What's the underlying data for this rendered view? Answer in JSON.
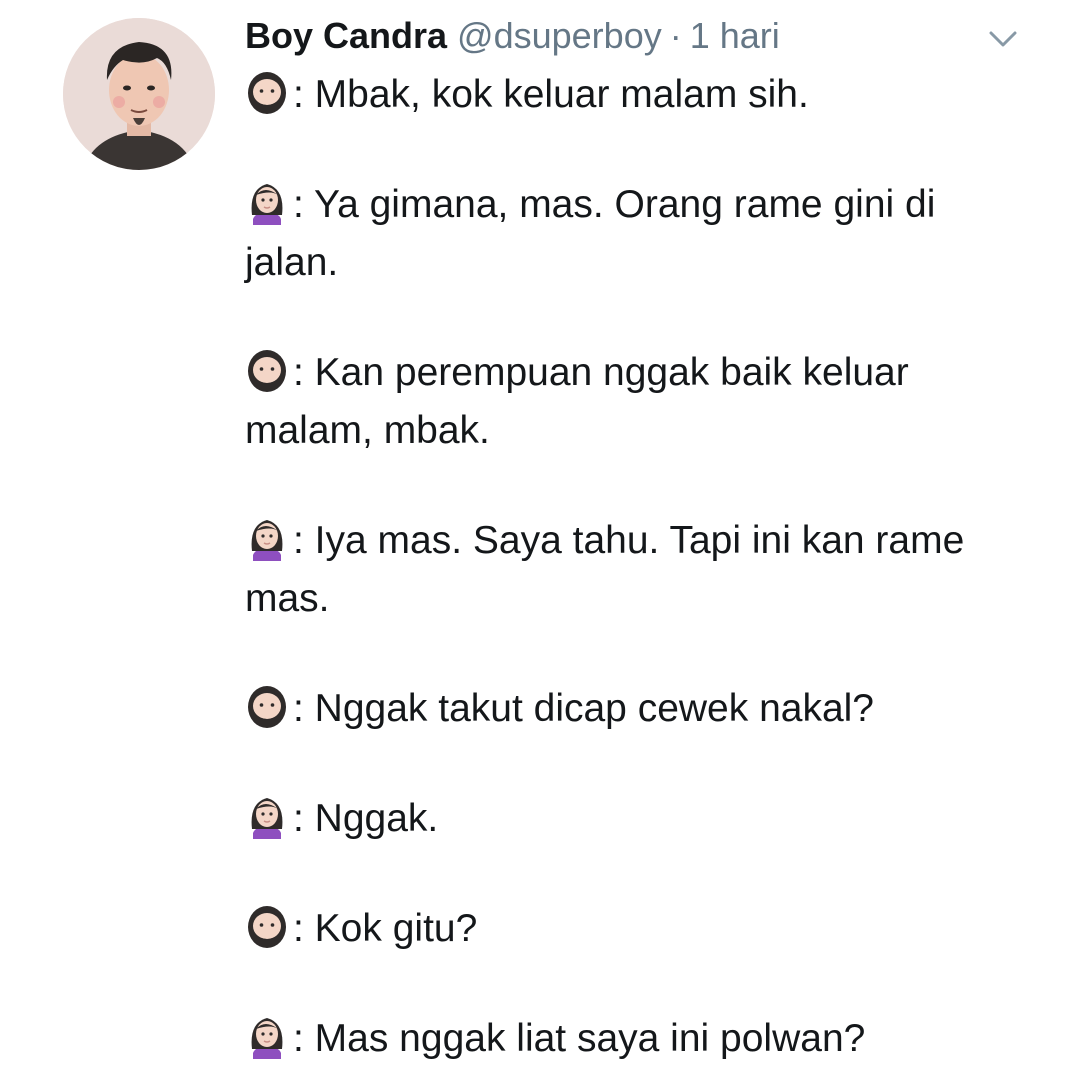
{
  "tweet": {
    "author": {
      "display_name": "Boy Candra",
      "handle": "@dsuperboy",
      "avatar": "profile-avatar"
    },
    "separator": "·",
    "timestamp": "1 hari",
    "menu_icon": "chevron-down-icon",
    "lines": [
      {
        "speaker": "man-emoji",
        "text": ": Mbak, kok keluar malam sih."
      },
      {
        "speaker": "woman-emoji",
        "text": ": Ya gimana, mas. Orang rame gini di jalan."
      },
      {
        "speaker": "man-emoji",
        "text": ": Kan perempuan nggak baik keluar malam, mbak."
      },
      {
        "speaker": "woman-emoji",
        "text": ": Iya mas. Saya tahu. Tapi ini kan rame mas."
      },
      {
        "speaker": "man-emoji",
        "text": ": Nggak takut dicap cewek nakal?"
      },
      {
        "speaker": "woman-emoji",
        "text": ": Nggak."
      },
      {
        "speaker": "man-emoji",
        "text": ": Kok gitu?"
      },
      {
        "speaker": "woman-emoji",
        "text": ": Mas nggak liat saya ini polwan?"
      }
    ]
  },
  "colors": {
    "text_primary": "#14171a",
    "text_secondary": "#657786",
    "background": "#ffffff"
  }
}
